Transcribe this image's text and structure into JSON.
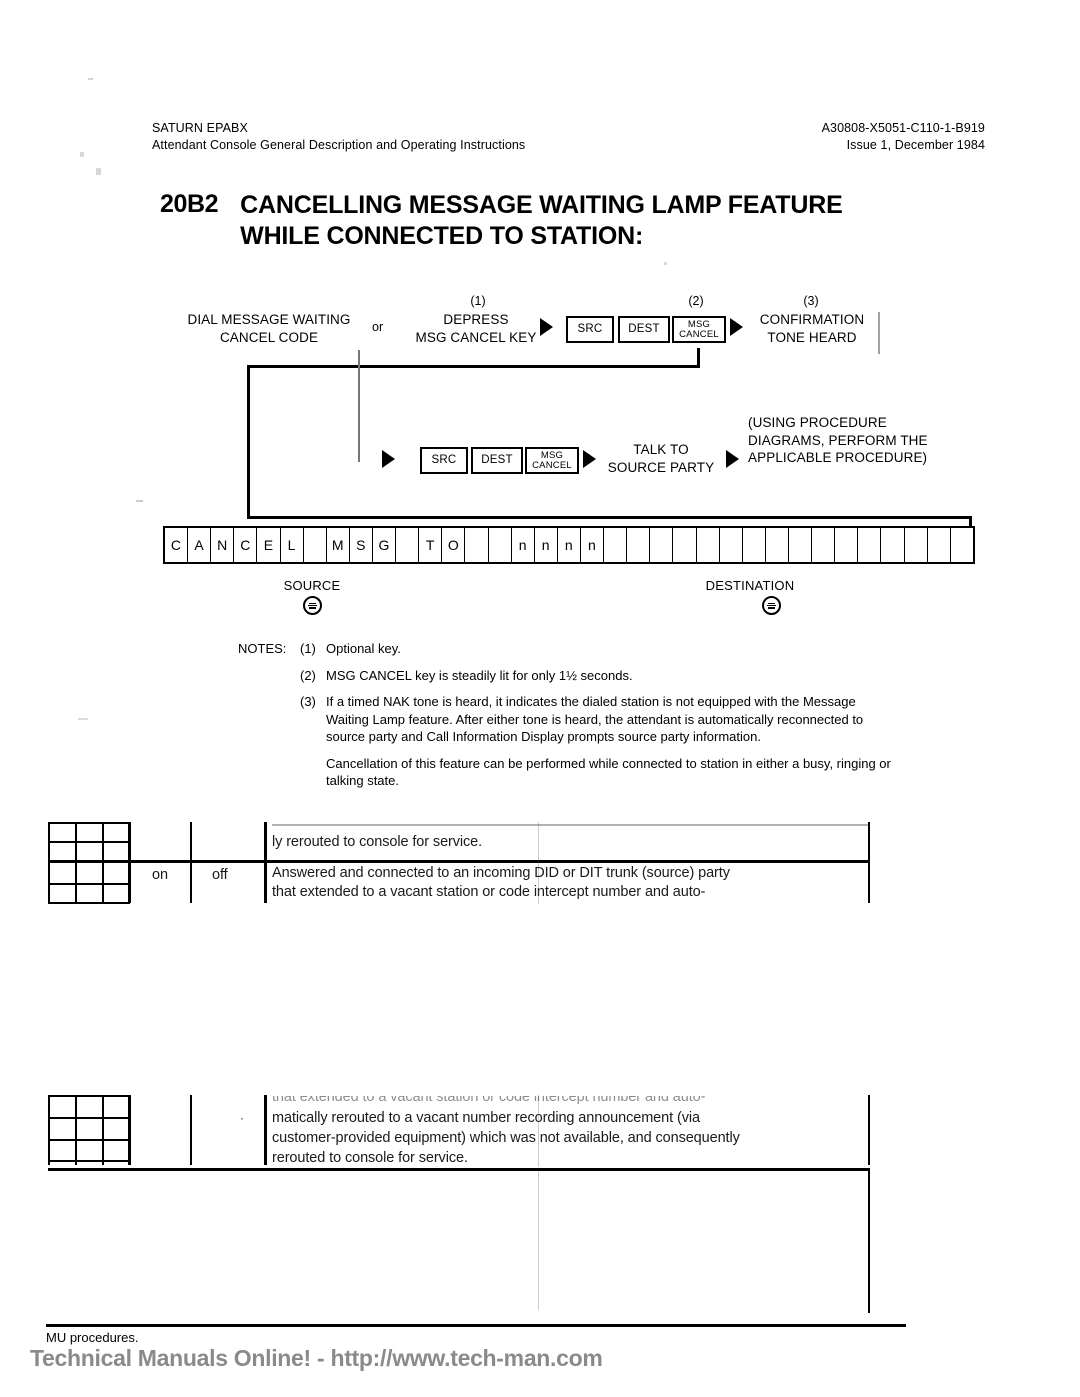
{
  "header": {
    "left_line1": "SATURN EPABX",
    "left_line2": "Attendant Console General Description and Operating Instructions",
    "right_line1": "A30808-X5051-C110-1-B919",
    "right_line2": "Issue 1, December 1984"
  },
  "title": {
    "number": "20B2",
    "line1": "CANCELLING MESSAGE WAITING LAMP FEATURE",
    "line2": "WHILE CONNECTED TO STATION:"
  },
  "flow": {
    "row1": {
      "step1_line1": "DIAL MESSAGE WAITING",
      "step1_line2": "CANCEL CODE",
      "conjunction": "or",
      "note1": "(1)",
      "step2_line1": "DEPRESS",
      "step2_line2": "MSG CANCEL KEY",
      "keys": [
        {
          "label": "SRC"
        },
        {
          "label": "DEST"
        },
        {
          "label_top": "MSG",
          "label_bottom": "CANCEL"
        }
      ],
      "note2": "(2)",
      "note3": "(3)",
      "step3_line1": "CONFIRMATION",
      "step3_line2": "TONE HEARD"
    },
    "row2": {
      "keys": [
        {
          "label": "SRC"
        },
        {
          "label": "DEST"
        },
        {
          "label_top": "MSG",
          "label_bottom": "CANCEL"
        }
      ],
      "step1_line1": "TALK TO",
      "step1_line2": "SOURCE PARTY",
      "step2_line1": "(USING PROCEDURE",
      "step2_line2": "DIAGRAMS, PERFORM THE",
      "step2_line3": "APPLICABLE PROCEDURE)"
    }
  },
  "display": {
    "cells": [
      "C",
      "A",
      "N",
      "C",
      "E",
      "L",
      "",
      "M",
      "S",
      "G",
      "",
      "T",
      "O",
      "",
      "",
      "n",
      "n",
      "n",
      "n",
      "",
      "",
      "",
      "",
      "",
      "",
      "",
      "",
      "",
      "",
      "",
      "",
      "",
      "",
      "",
      ""
    ],
    "source_label": "SOURCE",
    "destination_label": "DESTINATION"
  },
  "notes": {
    "heading": "NOTES:",
    "items": [
      {
        "num": "(1)",
        "text": "Optional key."
      },
      {
        "num": "(2)",
        "text": "MSG CANCEL key is steadily lit for only 1½ seconds."
      },
      {
        "num": "(3)",
        "text": "If a timed NAK tone is heard, it indicates the dialed station is not equipped with the Message Waiting Lamp feature. After either tone is heard, the attendant is automatically reconnected to source party and Call Information Display prompts source party information."
      }
    ],
    "continuation": "Cancellation of this feature can be performed while connected to station in either a busy, ringing or talking state."
  },
  "ghost_table": {
    "top_partial_line": "ly rerouted to console for service.",
    "row_on": "on",
    "row_off": "off",
    "row_text_line1": "Answered and connected to an incoming DID or DIT trunk (source) party",
    "row_text_line2": "that extended to a vacant station or code intercept number and auto-",
    "lower_clipped": "that extended to a vacant station or code intercept number and auto-",
    "lower_line1": "matically rerouted to a vacant number recording announcement (via",
    "lower_line2": "customer-provided equipment) which was not available, and consequently",
    "lower_line3": "rerouted to console for service."
  },
  "footer": {
    "mu_text": "MU procedures.",
    "watermark": "Technical Manuals Online! - http://www.tech-man.com"
  }
}
